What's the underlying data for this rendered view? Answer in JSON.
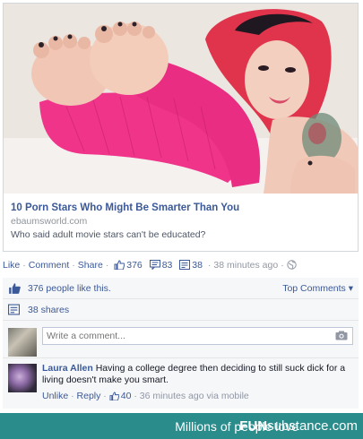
{
  "link": {
    "title": "10 Porn Stars Who Might Be Smarter Than You",
    "domain": "ebaumsworld.com",
    "description": "Who said adult movie stars can't be educated?"
  },
  "actions": {
    "like": "Like",
    "comment": "Comment",
    "share": "Share",
    "likes_count": "376",
    "comments_count": "83",
    "shares_count": "38",
    "time": "38 minutes ago"
  },
  "ufi": {
    "likes_text": "376 people like this.",
    "top_comments": "Top Comments",
    "shares_text": "38 shares",
    "comment_placeholder": "Write a comment..."
  },
  "comment": {
    "author": "Laura Allen",
    "text": "Having a college degree then deciding to still suck dick for a living doesn't make you smart.",
    "unlike": "Unlike",
    "reply": "Reply",
    "likes": "40",
    "time": "36 minutes ago via mobile"
  },
  "banner": {
    "message": "Millions of people love",
    "brand_bold": "FUN",
    "brand_rest": "substance.com"
  },
  "colors": {
    "link_blue": "#3b5998",
    "banner_teal": "#2b8c8c",
    "sweater_pink": "#f0348a",
    "hair_red": "#e0344c"
  }
}
